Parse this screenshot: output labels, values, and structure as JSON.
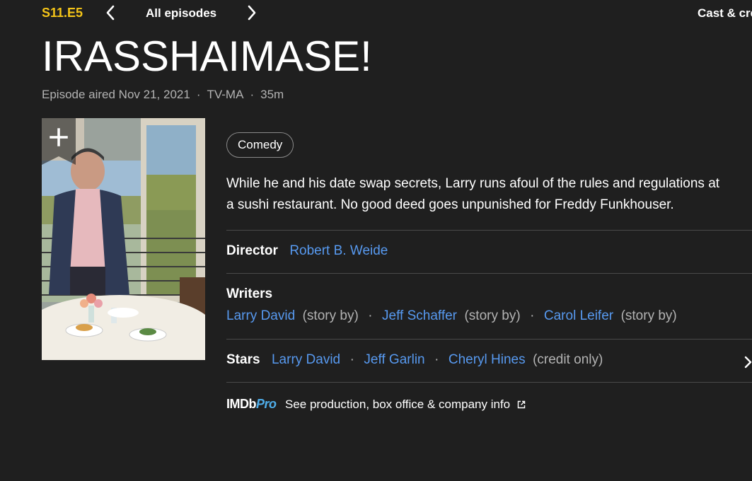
{
  "topbar": {
    "episode_code": "S11.E5",
    "all_episodes": "All episodes",
    "cast_crew": "Cast & crew"
  },
  "title": "IRASSHAIMASE!",
  "meta": {
    "aired": "Episode aired Nov 21, 2021",
    "rating": "TV-MA",
    "runtime": "35m",
    "dot": "·"
  },
  "genre": "Comedy",
  "plot": "While he and his date swap secrets, Larry runs afoul of the rules and regulations at a sushi restaurant. No good deed goes unpunished for Freddy Funkhouser.",
  "director": {
    "label": "Director",
    "name": "Robert B. Weide"
  },
  "writers": {
    "label": "Writers",
    "items": [
      {
        "name": "Larry David",
        "note": "(story by)"
      },
      {
        "name": "Jeff Schaffer",
        "note": "(story by)"
      },
      {
        "name": "Carol Leifer",
        "note": "(story by)"
      }
    ],
    "dot": "·"
  },
  "stars": {
    "label": "Stars",
    "items": [
      {
        "name": "Larry David"
      },
      {
        "name": "Jeff Garlin"
      },
      {
        "name": "Cheryl Hines",
        "note": "(credit only)"
      }
    ],
    "dot": "·"
  },
  "imdbpro": {
    "logo_imdb": "IMDb",
    "logo_pro": "Pro",
    "text": "See production, box office & company info"
  },
  "colors": {
    "accent_yellow": "#f5c518",
    "link_blue": "#5799ef",
    "background": "#1f1f1f"
  }
}
